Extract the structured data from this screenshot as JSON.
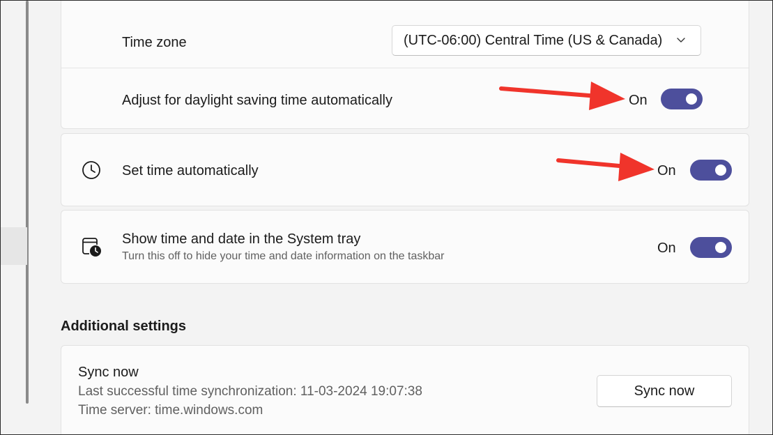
{
  "time_settings": {
    "time_zone": {
      "label": "Time zone",
      "value": "(UTC-06:00) Central Time (US & Canada)",
      "icon": "chevron-down-icon"
    },
    "daylight_saving": {
      "label": "Adjust for daylight saving time automatically",
      "state": "On",
      "enabled": true
    },
    "set_time_auto": {
      "label": "Set time automatically",
      "state": "On",
      "enabled": true,
      "icon": "clock-icon"
    },
    "system_tray": {
      "label": "Show time and date in the System tray",
      "description": "Turn this off to hide your time and date information on the taskbar",
      "state": "On",
      "enabled": true,
      "icon": "calendar-clock-icon"
    }
  },
  "additional_settings": {
    "title": "Additional settings",
    "sync": {
      "title": "Sync now",
      "last_sync": "Last successful time synchronization: 11-03-2024 19:07:38",
      "time_server": "Time server: time.windows.com",
      "button_label": "Sync now"
    }
  },
  "colors": {
    "accent": "#4d4f9c",
    "annotation_arrow": "#f0342b",
    "card_background": "#fbfbfb",
    "page_background": "#f3f3f3"
  }
}
